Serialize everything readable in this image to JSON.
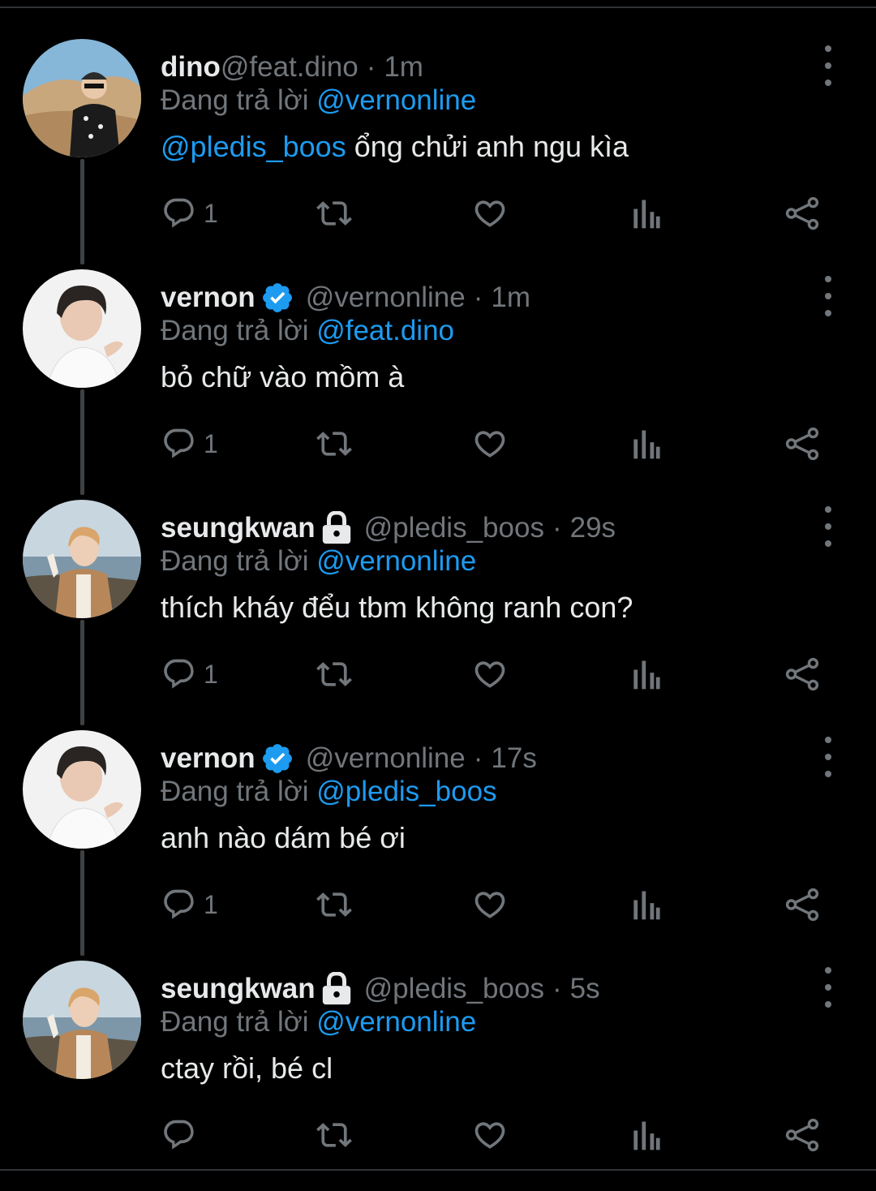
{
  "colors": {
    "background": "#000000",
    "text": "#e7e9ea",
    "muted": "#71767b",
    "accent": "#1d9bf0"
  },
  "tweets": [
    {
      "name": "dino",
      "badge": "",
      "handle": "@feat.dino",
      "time": "1m",
      "reply_prefix": "Đang trả lời",
      "reply_to": "@vernonline",
      "mention": "@pledis_boos",
      "text": " ổng chửi anh ngu kìa",
      "reply_count": "1",
      "avatar": "avatar-dino"
    },
    {
      "name": "vernon",
      "badge": "verified-icon",
      "handle": "@vernonline",
      "time": "1m",
      "reply_prefix": "Đang trả lời",
      "reply_to": "@feat.dino",
      "mention": "",
      "text": "bỏ chữ vào mồm à",
      "reply_count": "1",
      "avatar": "avatar-vernon"
    },
    {
      "name": "seungkwan",
      "badge": "lock-icon",
      "handle": "@pledis_boos",
      "time": "29s",
      "reply_prefix": "Đang trả lời",
      "reply_to": "@vernonline",
      "mention": "",
      "text": "thích kháy đểu tbm không ranh con?",
      "reply_count": "1",
      "avatar": "avatar-seungkwan"
    },
    {
      "name": "vernon",
      "badge": "verified-icon",
      "handle": "@vernonline",
      "time": "17s",
      "reply_prefix": "Đang trả lời",
      "reply_to": "@pledis_boos",
      "mention": "",
      "text": "anh nào dám bé ơi",
      "reply_count": "1",
      "avatar": "avatar-vernon"
    },
    {
      "name": "seungkwan",
      "badge": "lock-icon",
      "handle": "@pledis_boos",
      "time": "5s",
      "reply_prefix": "Đang trả lời",
      "reply_to": "@vernonline",
      "mention": "",
      "text": "ctay rồi, bé cl",
      "reply_count": "",
      "avatar": "avatar-seungkwan"
    }
  ],
  "icons": {
    "reply": "reply-icon",
    "retweet": "retweet-icon",
    "like": "heart-icon",
    "views": "views-icon",
    "share": "share-icon",
    "more": "more-vertical-icon"
  }
}
